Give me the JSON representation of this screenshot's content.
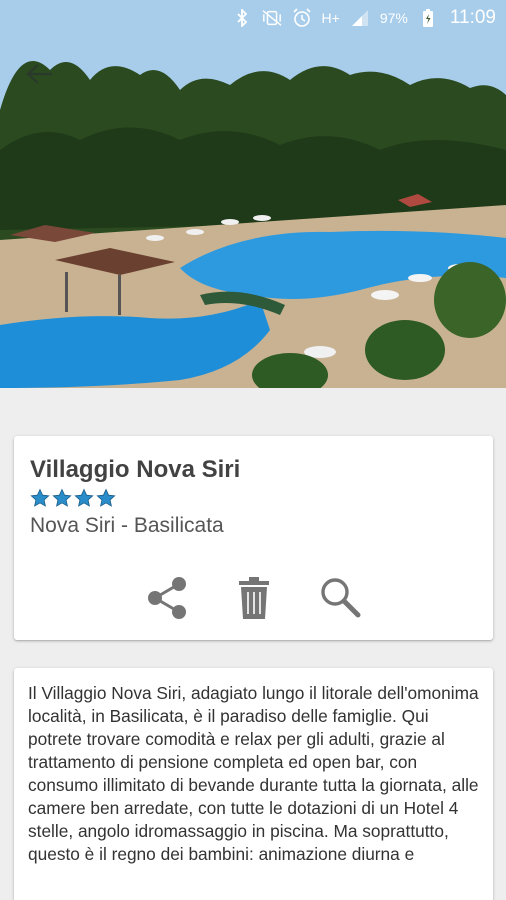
{
  "status_bar": {
    "battery": "97%",
    "time": "11:09",
    "network": "H+",
    "icons": [
      "bluetooth-icon",
      "vibrate-off-icon",
      "alarm-icon",
      "signal-icon",
      "battery-icon"
    ]
  },
  "header": {
    "back_icon": "back-arrow-icon",
    "image": "pool-resort-photo"
  },
  "info": {
    "title": "Villaggio Nova Siri",
    "rating": 4,
    "location": "Nova Siri - Basilicata"
  },
  "actions": [
    {
      "icon": "share-icon"
    },
    {
      "icon": "delete-icon"
    },
    {
      "icon": "search-icon"
    }
  ],
  "description": {
    "text": "Il Villaggio Nova Siri, adagiato lungo il litorale dell'omonima località, in Basilicata, è il paradiso delle famiglie. Qui potrete trovare comodità e relax per gli adulti, grazie al trattamento di pensione completa ed open bar, con consumo illimitato di bevande durante tutta la giornata, alle camere ben arredate, con tutte le dotazioni di un Hotel 4 stelle, angolo idromassaggio in piscina. Ma soprattutto, questo è il regno dei bambini: animazione diurna e"
  },
  "colors": {
    "accent": "#1e88c6",
    "star": "#2a8cc8",
    "icon_gray": "#757575",
    "background": "#eeeeee"
  }
}
